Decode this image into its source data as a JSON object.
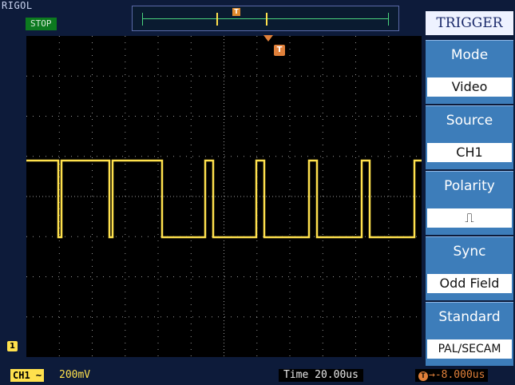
{
  "brand": "RIGOL",
  "run_status": "STOP",
  "memory_bar": {
    "trigger_marker": "T"
  },
  "trigger_marker": "T",
  "channel_marker": "1",
  "menu": {
    "title": "TRIGGER",
    "items": [
      {
        "label": "Mode",
        "value": "Video"
      },
      {
        "label": "Source",
        "value": "CH1"
      },
      {
        "label": "Polarity",
        "value": "⎍"
      },
      {
        "label": "Sync",
        "value": "Odd Field"
      },
      {
        "label": "Standard",
        "value": "PAL/SECAM"
      }
    ]
  },
  "status": {
    "ch1_label": "CH1",
    "ch1_coupling": "~",
    "ch1_scale": "200mV",
    "time_label": "Time",
    "time_value": "20.00us",
    "trig_icon": "T",
    "trig_offset": "-8.000us"
  },
  "colors": {
    "trace": "#ffe14d",
    "menu_blue": "#3d7dba",
    "trigger_orange": "#e0803a",
    "run_green": "#0c7a1f"
  }
}
